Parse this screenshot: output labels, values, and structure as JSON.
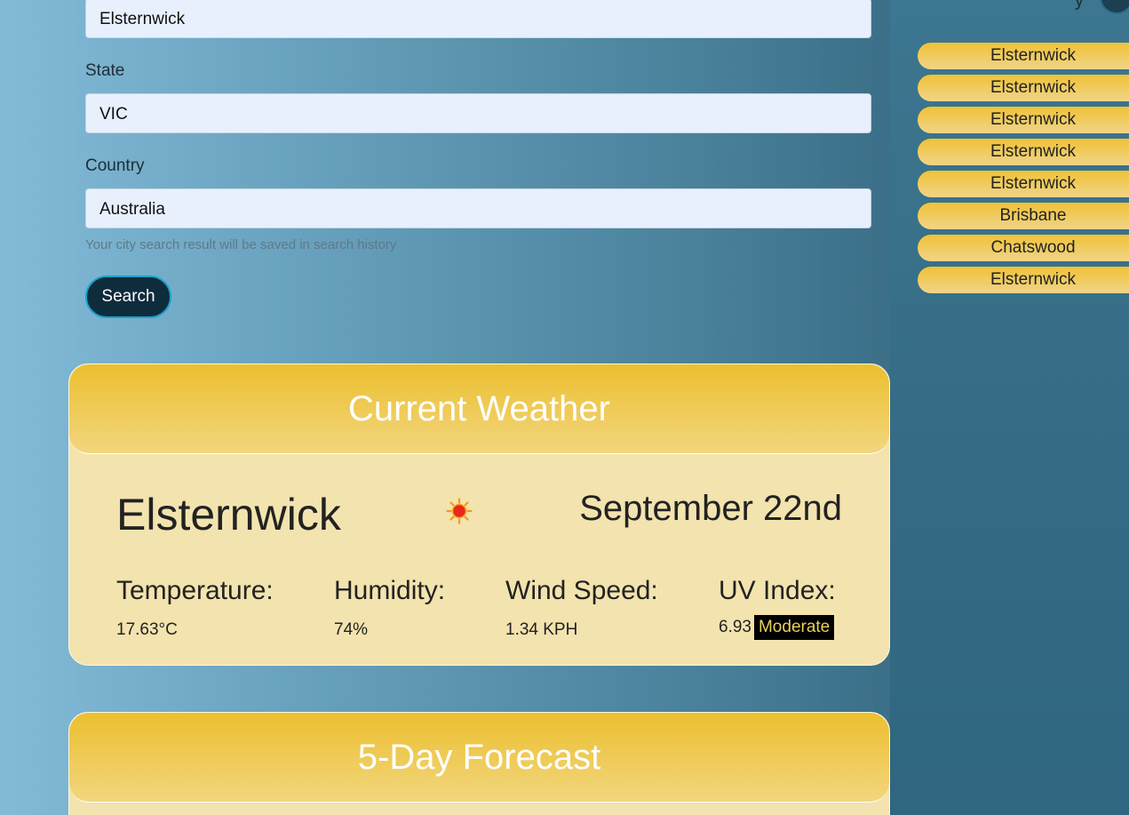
{
  "form": {
    "city_value": "Elsternwick",
    "state_label": "State",
    "state_value": "VIC",
    "country_label": "Country",
    "country_value": "Australia",
    "hint": "Your city search result will be saved in search history",
    "search_button": "Search"
  },
  "sidebar": {
    "top_partial_text": "y",
    "history": [
      {
        "label": "Elsternwick"
      },
      {
        "label": "Elsternwick"
      },
      {
        "label": "Elsternwick"
      },
      {
        "label": "Elsternwick"
      },
      {
        "label": "Elsternwick"
      },
      {
        "label": "Brisbane"
      },
      {
        "label": "Chatswood"
      },
      {
        "label": "Elsternwick"
      }
    ]
  },
  "current": {
    "header": "Current Weather",
    "city": "Elsternwick",
    "weather_icon": "sun-icon",
    "date": "September 22nd",
    "temperature_label": "Temperature:",
    "temperature_value": "17.63°C",
    "humidity_label": "Humidity:",
    "humidity_value": "74%",
    "wind_label": "Wind Speed:",
    "wind_value": "1.34 KPH",
    "uv_label": "UV Index:",
    "uv_value": "6.93",
    "uv_rating": "Moderate"
  },
  "forecast": {
    "header": "5-Day Forecast"
  },
  "colors": {
    "accent_yellow": "#ecbf2f",
    "card_bg": "#f3e3ae",
    "button_bg": "#0f2c3d",
    "button_border": "#1aa3c9",
    "uv_badge_bg": "#000000",
    "uv_badge_text": "#e8d05a"
  }
}
